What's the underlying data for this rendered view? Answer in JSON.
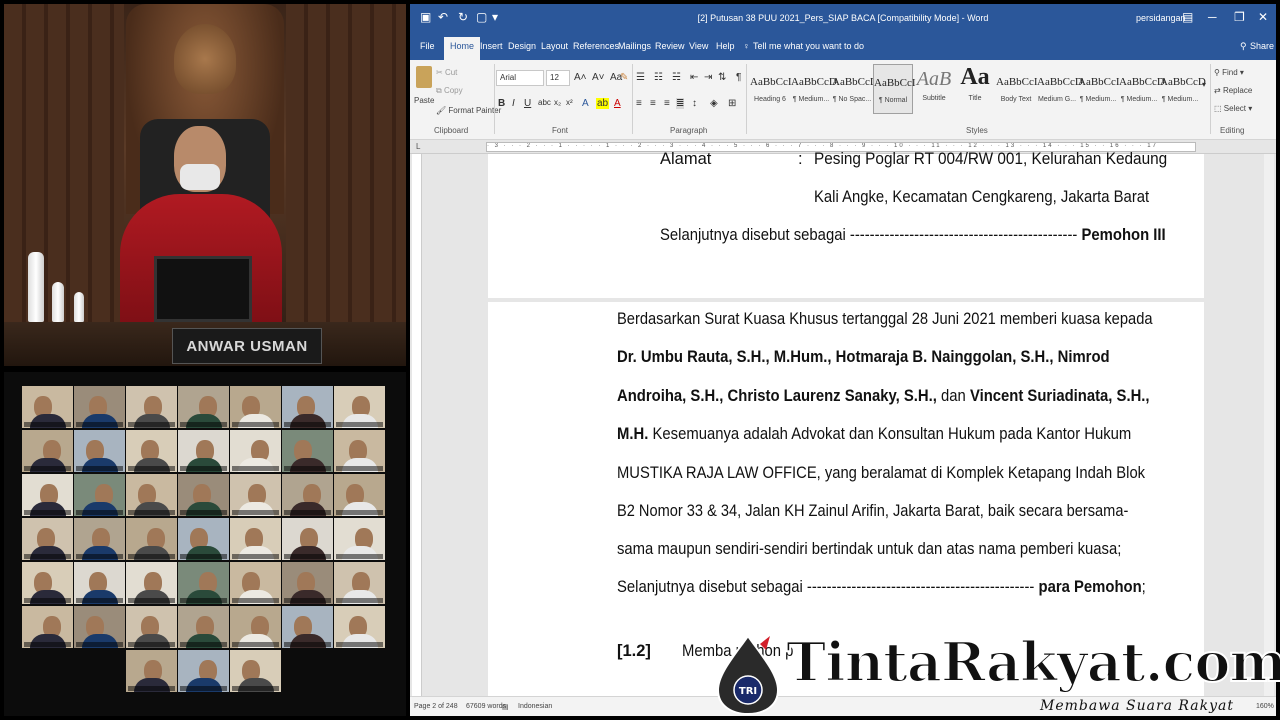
{
  "judge_panel": {
    "nameplate": "ANWAR USMAN"
  },
  "word": {
    "title": "[2] Putusan 38 PUU 2021_Pers_SIAP BACA [Compatibility Mode] - Word",
    "user": "persidangan",
    "tabs": [
      "File",
      "Home",
      "Insert",
      "Design",
      "Layout",
      "References",
      "Mailings",
      "Review",
      "View",
      "Help"
    ],
    "tell_me": "Tell me what you want to do",
    "share": "Share",
    "clipboard": {
      "paste": "Paste",
      "cut": "Cut",
      "copy": "Copy",
      "format_painter": "Format Painter",
      "group": "Clipboard"
    },
    "font": {
      "name": "Arial",
      "size": "12",
      "group": "Font"
    },
    "paragraph_group": "Paragraph",
    "styles_group": "Styles",
    "styles": [
      {
        "preview": "AaBbCcI",
        "name": "Heading 6"
      },
      {
        "preview": "AaBbCcD",
        "name": "¶ Medium..."
      },
      {
        "preview": "AaBbCcD",
        "name": "¶ No Spac..."
      },
      {
        "preview": "AaBbCcI",
        "name": "¶ Normal",
        "selected": true
      },
      {
        "preview": "AaB",
        "name": "Subtitle"
      },
      {
        "preview": "Aa",
        "name": "Title"
      },
      {
        "preview": "AaBbCcI",
        "name": "Body Text"
      },
      {
        "preview": "AaBbCcD",
        "name": "Medium G..."
      },
      {
        "preview": "AaBbCcI",
        "name": "¶ Medium..."
      },
      {
        "preview": "AaBbCcD",
        "name": "¶ Medium..."
      },
      {
        "preview": "AaBbCcD",
        "name": "¶ Medium..."
      }
    ],
    "editing": {
      "find": "Find",
      "replace": "Replace",
      "select": "Select",
      "group": "Editing"
    },
    "ruler_text": "· 3 · · · 2 · · · 1 · · · · · 1 · · · 2 · · · 3 · · · 4 · · · 5 · · · 6 · · · 7 · · · 8 · · · 9 · · · 10 · · · 11 · · · 12 · · · 13 · · · 14 · · · 15 · · 16 · · · 17",
    "page1": {
      "line0_label": "Alamat",
      "line0_colon": ":",
      "line0_value": "Pesing Poglar RT 004/RW 001, Kelurahan Kedaung",
      "line1": "Kali Angke, Kecamatan Cengkareng, Jakarta Barat",
      "line2_a": "Selanjutnya disebut sebagai ----------------------------------------------",
      "line2_b": "Pemohon III"
    },
    "page2": {
      "l1": "Berdasarkan Surat Kuasa Khusus tertanggal 28 Juni 2021 memberi kuasa kepada",
      "l2": "Dr. Umbu Rauta, S.H., M.Hum., Hotmaraja B. Nainggolan, S.H., Nimrod",
      "l3_a": "Androiha, S.H., Christo Laurenz Sanaky, S.H.,",
      "l3_b": "dan",
      "l3_c": "Vincent Suriadinata, S.H.,",
      "l4_a": "M.H.",
      "l4_b": "Kesemuanya adalah Advokat dan Konsultan Hukum pada Kantor Hukum",
      "l5": "MUSTIKA RAJA LAW OFFICE, yang beralamat di Komplek Ketapang Indah Blok",
      "l6": "B2 Nomor 33 & 34, Jalan KH Zainul Arifin, Jakarta Barat, baik secara bersama-",
      "l7": "sama maupun sendiri-sendiri bertindak untuk dan atas nama pemberi kuasa;",
      "l8_a": "Selanjutnya disebut sebagai ----------------------------------------------",
      "l8_b": "para Pemohon",
      "l8_c": ";",
      "l9_num": "[1.2]",
      "l9_text": "Memba     mohon p"
    },
    "status": {
      "page": "Page 2 of 248",
      "words": "67609 words",
      "language": "Indonesian",
      "zoom": "160%"
    }
  },
  "watermark": {
    "brand": "TintaRakyat.com",
    "badge": "TRI",
    "tagline": "Membawa Suara Rakyat"
  },
  "colors": {
    "word_blue": "#2b579a",
    "robe_red": "#b11a22"
  }
}
